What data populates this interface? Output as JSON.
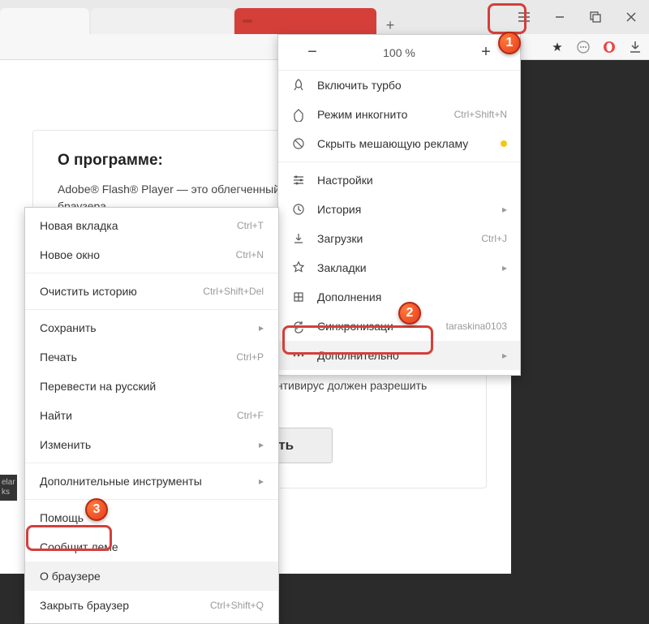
{
  "window": {
    "tab1": "",
    "tab2": "",
    "tab3": "",
    "zoom": "100 %"
  },
  "card": {
    "title": "О программе:",
    "desc": "Adobe® Flash® Player — это облегченный подключаемый модуль для браузера",
    "note": "Примечание. Установленный в системе антивирус должен разрешить установку программного обеспечения.",
    "download": "Загрузить"
  },
  "menu": {
    "turbo": "Включить турбо",
    "incognito": "Режим инкогнито",
    "incognito_sc": "Ctrl+Shift+N",
    "hide_ads": "Скрыть мешающую рекламу",
    "settings": "Настройки",
    "history": "История",
    "downloads": "Загрузки",
    "downloads_sc": "Ctrl+J",
    "bookmarks": "Закладки",
    "addons": "Дополнения",
    "sync": "Синхронизаци",
    "sync_user": "taraskina0103",
    "more": "Дополнительно"
  },
  "submenu": {
    "new_tab": "Новая вкладка",
    "new_tab_sc": "Ctrl+T",
    "new_window": "Новое окно",
    "new_window_sc": "Ctrl+N",
    "clear_history": "Очистить историю",
    "clear_history_sc": "Ctrl+Shift+Del",
    "save": "Сохранить",
    "print": "Печать",
    "print_sc": "Ctrl+P",
    "translate": "Перевести на русский",
    "find": "Найти",
    "find_sc": "Ctrl+F",
    "edit": "Изменить",
    "dev_tools": "Дополнительные инструменты",
    "help": "Помощь",
    "report": "Сообщит             леме",
    "about": "О браузере",
    "quit": "Закрыть браузер",
    "quit_sc": "Ctrl+Shift+Q"
  },
  "callouts": {
    "c1": "1",
    "c2": "2",
    "c3": "3"
  }
}
